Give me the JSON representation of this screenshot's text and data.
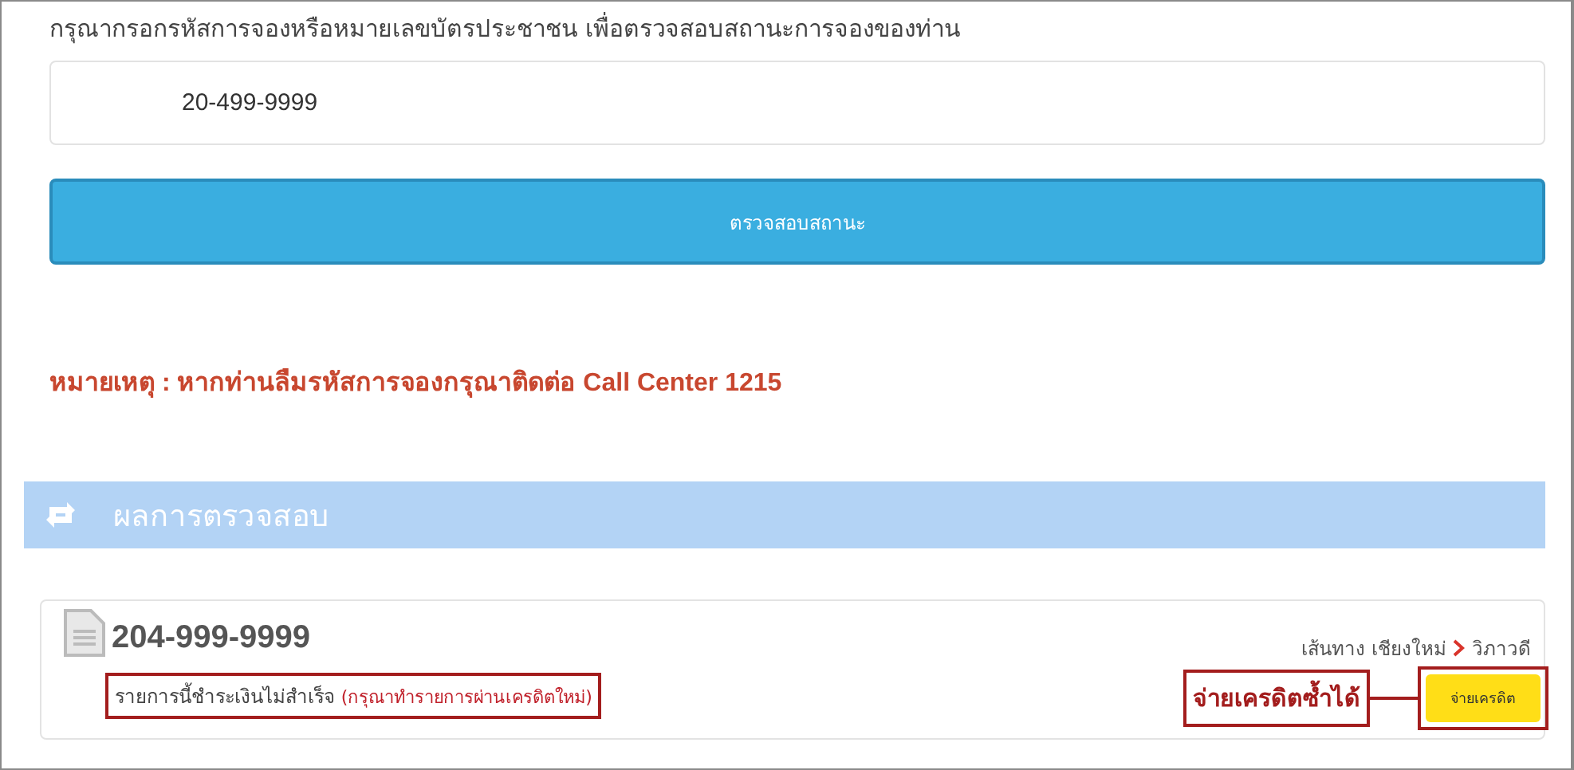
{
  "search": {
    "heading": "กรุณากรอกรหัสการจองหรือหมายเลขบัตรประชาชน เพื่อตรวจสอบสถานะการจองของท่าน",
    "value": "20-499-9999"
  },
  "check_button": "ตรวจสอบสถานะ",
  "note": "หมายเหตุ : หากท่านลืมรหัสการจองกรุณาติดต่อ Call Center 1215",
  "results": {
    "title": "ผลการตรวจสอบ",
    "booking": {
      "code": "204-999-9999",
      "route_label": "เส้นทาง",
      "origin": "เชียงใหม่",
      "destination": "วิภาวดี",
      "status": "รายการนี้ชำระเงินไม่สำเร็จ",
      "hint": "(กรุณาทำรายการผ่านเครดิตใหม่)",
      "pay_button": "จ่ายเครดิต"
    }
  },
  "annotation": {
    "callout": "จ่ายเครดิตซ้ำได้"
  }
}
